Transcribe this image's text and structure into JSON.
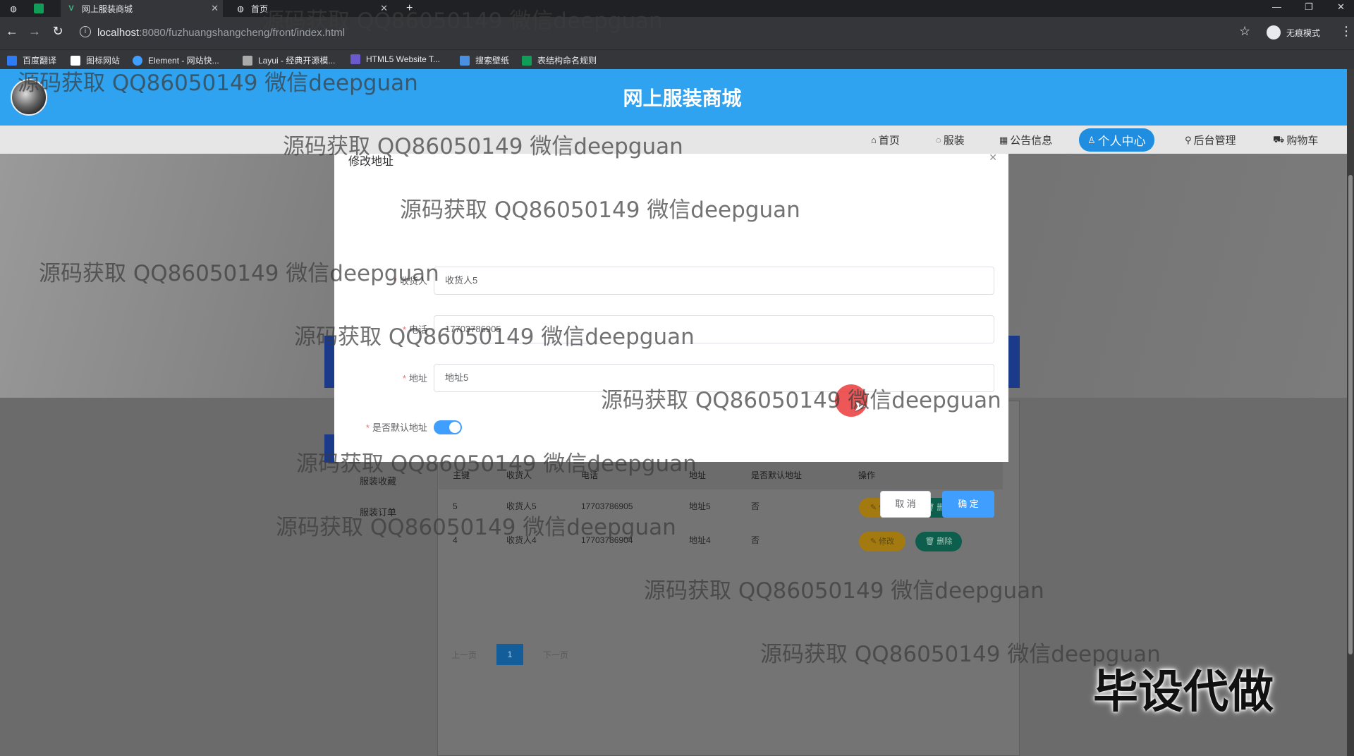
{
  "browser": {
    "tabs": [
      {
        "title": ""
      },
      {
        "title": ""
      },
      {
        "title": "网上服装商城"
      },
      {
        "title": "首页"
      }
    ],
    "url_host": "localhost",
    "url_path": ":8080/fuzhuangshangcheng/front/index.html",
    "profile_label": "无痕模式",
    "bookmarks": [
      {
        "label": "百度翻译",
        "color": "#2d7cf6"
      },
      {
        "label": "图标网站",
        "color": "#ffffff"
      },
      {
        "label": "Element - 网站快...",
        "color": "#409eff"
      },
      {
        "label": "Layui - 经典开源模...",
        "color": "#aaaaaa"
      },
      {
        "label": "HTML5 Website T...",
        "color": "#6a5acd"
      },
      {
        "label": "搜索壁纸",
        "color": "#4a90e2"
      },
      {
        "label": "表结构命名规则",
        "color": "#0f9d58"
      }
    ]
  },
  "site": {
    "title": "网上服装商城",
    "nav": [
      {
        "label": "首页",
        "icon": "home-icon"
      },
      {
        "label": "服装",
        "icon": "tag-icon"
      },
      {
        "label": "公告信息",
        "icon": "notice-icon"
      },
      {
        "label": "个人中心",
        "icon": "user-icon",
        "active": true
      },
      {
        "label": "后台管理",
        "icon": "link-icon"
      },
      {
        "label": "购物车",
        "icon": "cart-icon"
      }
    ]
  },
  "side_menu": [
    "服装收藏",
    "服装订单"
  ],
  "table": {
    "headers": [
      "主键",
      "收货人",
      "电话",
      "地址",
      "是否默认地址",
      "操作"
    ],
    "rows": [
      [
        "5",
        "收货人5",
        "17703786905",
        "地址5",
        "否"
      ],
      [
        "4",
        "收货人4",
        "17703786904",
        "地址4",
        "否"
      ]
    ],
    "edit_label": "修改",
    "delete_label": "删除"
  },
  "pager": {
    "prev": "上一页",
    "current": "1",
    "next": "下一页"
  },
  "dialog": {
    "title": "修改地址",
    "fields": [
      {
        "label": "收货人",
        "value": "收货人5"
      },
      {
        "label": "电话",
        "value": "17703786905"
      },
      {
        "label": "地址",
        "value": "地址5"
      }
    ],
    "default_label": "是否默认地址",
    "default_on": true,
    "cancel_label": "取 消",
    "ok_label": "确 定"
  },
  "watermark": "源码获取 QQ86050149 微信deepguan",
  "promo": "毕设代做",
  "colors": {
    "primary": "#409eff",
    "header": "#2fa2f0",
    "danger": "#f56c6c"
  }
}
